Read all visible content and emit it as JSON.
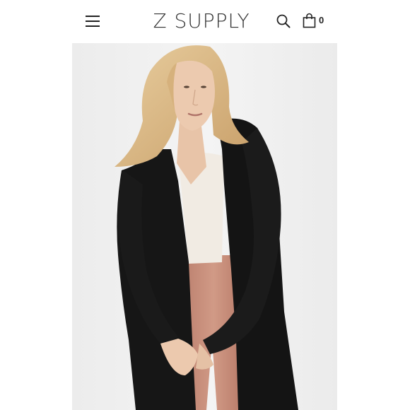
{
  "header": {
    "brand": "Z SUPPLY",
    "cart_count": "0"
  },
  "icons": {
    "menu": "hamburger-menu-icon",
    "search": "search-icon",
    "cart": "shopping-bag-icon"
  },
  "colors": {
    "text": "#333333",
    "background": "#ffffff",
    "photo_background": "#efefef",
    "garment": "#151515",
    "pants": "#c98f7a",
    "top": "#f3ede6",
    "hair": "#d9b785",
    "skin": "#eac7ad"
  }
}
